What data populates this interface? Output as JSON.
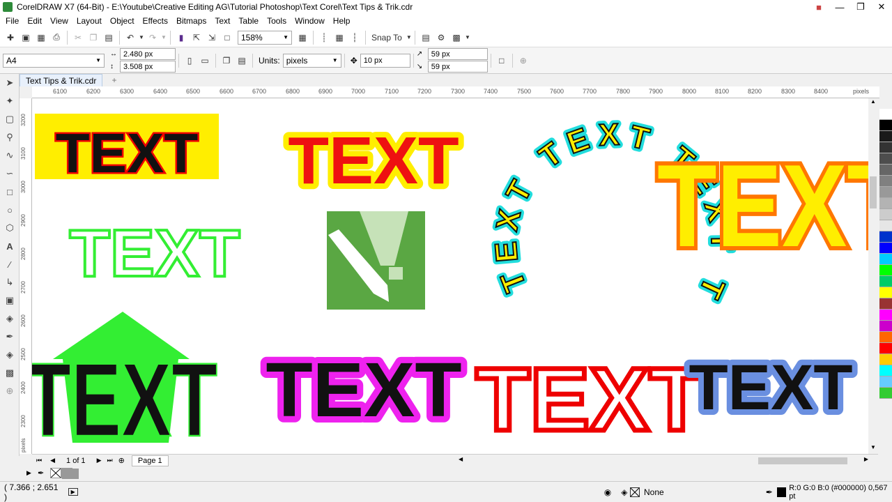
{
  "window": {
    "title": "CorelDRAW X7 (64-Bit) - E:\\Youtube\\Creative Editing AG\\Tutorial Photoshop\\Text Corel\\Text Tips & Trik.cdr"
  },
  "menu": [
    "File",
    "Edit",
    "View",
    "Layout",
    "Object",
    "Effects",
    "Bitmaps",
    "Text",
    "Table",
    "Tools",
    "Window",
    "Help"
  ],
  "toolbar": {
    "zoom": "158%",
    "snap_to": "Snap To"
  },
  "propbar": {
    "page_size": "A4",
    "width": "2.480 px",
    "height": "3.508 px",
    "units_label": "Units:",
    "units": "pixels",
    "nudge": "10 px",
    "dup_x": "59 px",
    "dup_y": "59 px"
  },
  "document": {
    "tab": "Text Tips & Trik.cdr"
  },
  "rulers": {
    "h_ticks": [
      "6100",
      "6200",
      "6300",
      "6400",
      "6500",
      "6600",
      "6700",
      "6800",
      "6900",
      "7000",
      "7100",
      "7200",
      "7300",
      "7400",
      "7500",
      "7600",
      "7700",
      "7800",
      "7900",
      "8000",
      "8100",
      "8200",
      "8300",
      "8400"
    ],
    "h_unit": "pixels",
    "v_ticks": [
      "3200",
      "3100",
      "3000",
      "2900",
      "2800",
      "2700",
      "2600",
      "2500",
      "2400",
      "2300"
    ],
    "v_unit": "pixels"
  },
  "artwork": {
    "word": "TEXT"
  },
  "pagenav": {
    "counter": "1 of 1",
    "page_tab": "Page 1"
  },
  "status": {
    "coords": "( 7.366 ; 2.651 )",
    "fill": "None",
    "outline": "R:0 G:0 B:0 (#000000)  0,567 pt"
  },
  "colors": {
    "palette": [
      "#ffffff",
      "#000000",
      "#1a1a1a",
      "#333333",
      "#4d4d4d",
      "#666666",
      "#808080",
      "#999999",
      "#b3b3b3",
      "#cccccc",
      "#e6e6e6",
      "#0033cc",
      "#0000ff",
      "#00ccff",
      "#00ff00",
      "#00cc66",
      "#ffff00",
      "#993333",
      "#ff00ff",
      "#cc00cc",
      "#ff6600",
      "#ff0000",
      "#ffcc00",
      "#00ffff",
      "#66ccff",
      "#33cc33"
    ],
    "doc_palette": [
      "#ff0000",
      "#0000ff",
      "#ffffff",
      "#00ff00",
      "#00ffff",
      "#ff00ff",
      "#00ff66",
      "#1e90ff",
      "#000000",
      "#ff6600",
      "#ffee00",
      "#6699ee"
    ]
  }
}
